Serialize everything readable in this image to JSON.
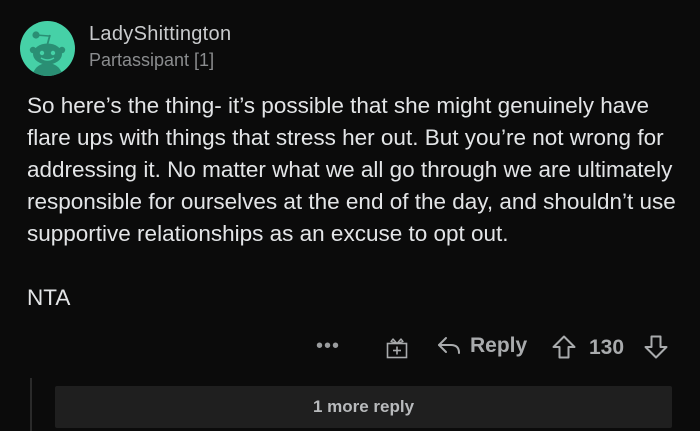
{
  "comment": {
    "username": "LadyShittington",
    "flair": "Partassipant [1]",
    "body": "So here’s the thing- it’s possible that she might genuinely have flare ups with things that stress her out. But you’re not wrong for addressing it. No matter what we all go through we are ultimately responsible for ourselves at the end of the day, and shouldn’t use supportive relationships as an excuse to opt out.",
    "verdict": "NTA"
  },
  "actions": {
    "more_label": "•••",
    "award_icon": "gift-award-icon",
    "reply_label": "Reply",
    "vote_count": "130"
  },
  "replies": {
    "more_label": "1 more reply"
  },
  "colors": {
    "background": "#0b0b0b",
    "avatar": "#46d1a7",
    "text": "#e3e5e7",
    "muted": "#8a8c8e"
  }
}
